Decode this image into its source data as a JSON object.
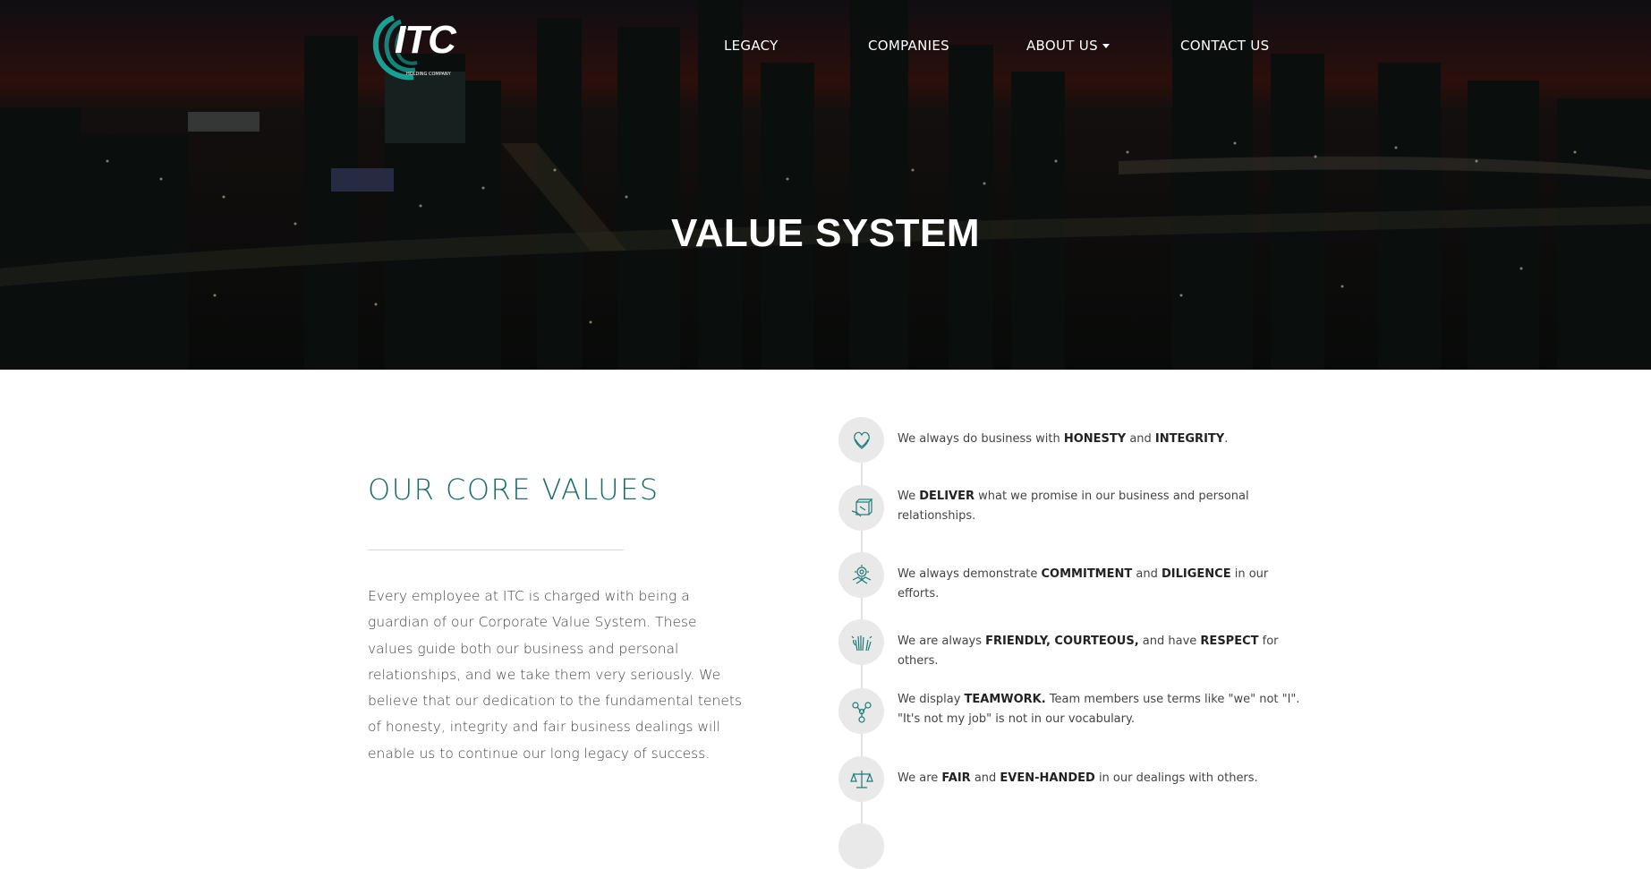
{
  "header": {
    "logo_text": "ITC",
    "logo_subtext": "HOLDING COMPANY",
    "nav": [
      {
        "label": "LEGACY"
      },
      {
        "label": "COMPANIES"
      },
      {
        "label": "ABOUT US",
        "has_dropdown": true
      },
      {
        "label": "CONTACT US"
      }
    ]
  },
  "hero": {
    "title": "VALUE SYSTEM"
  },
  "core": {
    "heading": "OUR CORE VALUES",
    "intro": "Every employee at ITC is charged with being a guardian of our Corporate Value System. These values guide both our business and personal relationships, and we take them very seriously. We believe that our dedication to the fundamental tenets of honesty, integrity and fair business dealings will enable us to continue our long legacy of success."
  },
  "values": [
    {
      "icon": "heart-hands-icon",
      "parts": [
        [
          "We always do business with ",
          false
        ],
        [
          "HONESTY",
          true
        ],
        [
          " and ",
          false
        ],
        [
          "INTEGRITY",
          true
        ],
        [
          ".",
          false
        ]
      ]
    },
    {
      "icon": "delivery-box-icon",
      "parts": [
        [
          "We ",
          false
        ],
        [
          "DELIVER",
          true
        ],
        [
          " what we promise in our business and personal relationships.",
          false
        ]
      ]
    },
    {
      "icon": "handshake-gear-icon",
      "parts": [
        [
          "We always demonstrate ",
          false
        ],
        [
          "COMMITMENT",
          true
        ],
        [
          " and ",
          false
        ],
        [
          "DILIGENCE",
          true
        ],
        [
          " in our efforts.",
          false
        ]
      ]
    },
    {
      "icon": "waving-hands-icon",
      "parts": [
        [
          "We are always ",
          false
        ],
        [
          "FRIENDLY, COURTEOUS,",
          true
        ],
        [
          " and have ",
          false
        ],
        [
          "RESPECT",
          true
        ],
        [
          " for others.",
          false
        ]
      ]
    },
    {
      "icon": "teamwork-icon",
      "parts": [
        [
          "We display ",
          false
        ],
        [
          "TEAMWORK.",
          true
        ],
        [
          " Team members use terms like \"we\" not \"I\". \"It's not my job\" is not in our vocabulary.",
          false
        ]
      ]
    },
    {
      "icon": "scales-icon",
      "parts": [
        [
          "We are ",
          false
        ],
        [
          "FAIR",
          true
        ],
        [
          " and ",
          false
        ],
        [
          "EVEN-HANDED",
          true
        ],
        [
          " in our dealings with others.",
          false
        ]
      ]
    }
  ],
  "colors": {
    "accent": "#1b6b6c",
    "icon_bg": "#e9e9e9",
    "icon_stroke": "#1f7a79"
  }
}
